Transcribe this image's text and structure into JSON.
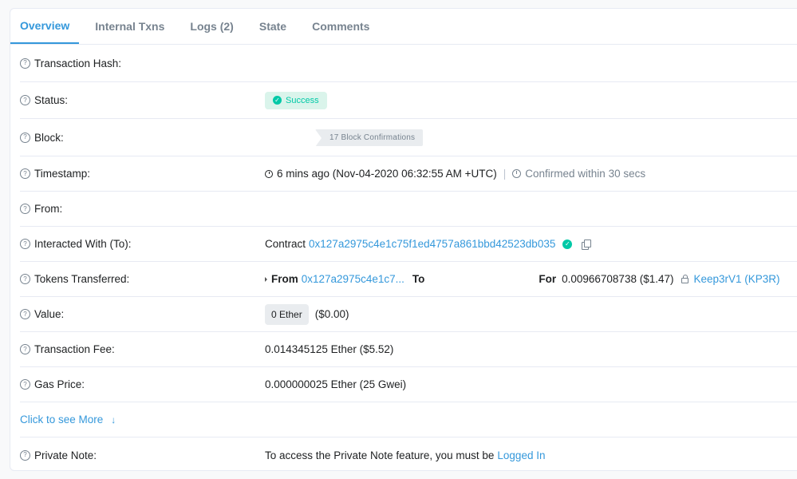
{
  "tabs": [
    {
      "label": "Overview"
    },
    {
      "label": "Internal Txns"
    },
    {
      "label": "Logs (2)"
    },
    {
      "label": "State"
    },
    {
      "label": "Comments"
    }
  ],
  "rows": {
    "tx_hash": {
      "label": "Transaction Hash:"
    },
    "status": {
      "label": "Status:",
      "value": "Success"
    },
    "block": {
      "label": "Block:",
      "confirmations": "17 Block Confirmations"
    },
    "timestamp": {
      "label": "Timestamp:",
      "value": "6 mins ago (Nov-04-2020 06:32:55 AM +UTC)",
      "separator": "|",
      "confirmed": "Confirmed within 30 secs"
    },
    "from": {
      "label": "From:"
    },
    "interacted": {
      "label": "Interacted With (To):",
      "prefix": "Contract",
      "address": "0x127a2975c4e1c75f1ed4757a861bbd42523db035"
    },
    "tokens": {
      "label": "Tokens Transferred:",
      "from_label": "From",
      "from_address": "0x127a2975c4e1c7...",
      "to_label": "To",
      "for_label": "For",
      "amount": "0.00966708738 ($1.47)",
      "token": "Keep3rV1 (KP3R)"
    },
    "value": {
      "label": "Value:",
      "ether": "0 Ether",
      "usd": "($0.00)"
    },
    "fee": {
      "label": "Transaction Fee:",
      "value": "0.014345125 Ether ($5.52)"
    },
    "gas": {
      "label": "Gas Price:",
      "value": "0.000000025 Ether (25 Gwei)"
    },
    "more": {
      "label": "Click to see More",
      "arrow": "↓"
    },
    "private_note": {
      "label": "Private Note:",
      "text": "To access the Private Note feature, you must be",
      "link": "Logged In"
    }
  },
  "icons": {
    "help": "?",
    "check": "✓"
  },
  "colors": {
    "accent": "#3498db",
    "success": "#00c9a7",
    "success_bg": "#daf4eb",
    "muted": "#77838f",
    "border": "#e7eaf3"
  }
}
